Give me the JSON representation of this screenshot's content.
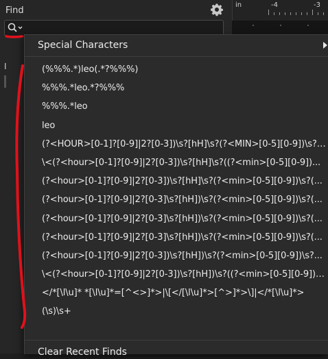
{
  "find_panel": {
    "title": "Find",
    "gear_icon": "gear-icon",
    "search_icon": "search-icon",
    "left_marker": "I"
  },
  "ruler": {
    "labels": [
      "-4",
      "-3"
    ],
    "corner_mark": "in"
  },
  "menu": {
    "special_characters": "Special Characters",
    "recent_finds": [
      "(%%%.*)leo(.*?%%%)",
      "%%%.*leo.*?%%%",
      "%%%.*leo",
      "leo",
      "(?<HOUR>[0-1]?[0-9]|2?[0-3])\\s?[hH]\\s?(?<MIN>[0-5][0-9])\\s?(...",
      "\\<(?<hour>[0-1]?[0-9]|2?[0-3])\\s?[hH]\\s?((?<min>[0-5][0-9])...",
      "(?<hour>[0-1]?[0-9]|2?[0-3])\\s?[hH]\\s?(?<min>[0-5][0-9])\\s?(...",
      "(?<hour>[0-1]?[0-9]|2?[0-3]\\s?[hH])\\s?(?<min>[0-5][0-9])\\s?(...",
      "(?<hour>[0-1]?[0-9]|2?[0-3]\\s?[hH])\\s?(?<min>[0-5][0-9])\\s?(...",
      "(?<hour>[0-1]?[0-9]|2?[0-3]\\s?[hH])\\s?(?<min>[0-5][0-9])\\s?(...",
      "(?<hour>[0-1]?[0-9]|2?[0-3])\\s?[hH])\\s?(?<min>[0-5][0-9])\\s?...",
      "\\<(?<hour>[0-1]?[0-9]|2?[0-3])\\s?[hH])\\s?((?<min>[0-5][0-9])\\...",
      "</*[\\l\\u]* *[\\l\\u]*=[^<>]*>|\\[</[\\l\\u]*>[^>]*>\\]|</*[\\l\\u]*>",
      "(\\s)\\s+"
    ],
    "clear_recent_finds": "Clear Recent Finds"
  },
  "colors": {
    "annotation_red": "#e0111b",
    "menu_bg": "#2b2b2b",
    "panel_bg": "#262626"
  }
}
